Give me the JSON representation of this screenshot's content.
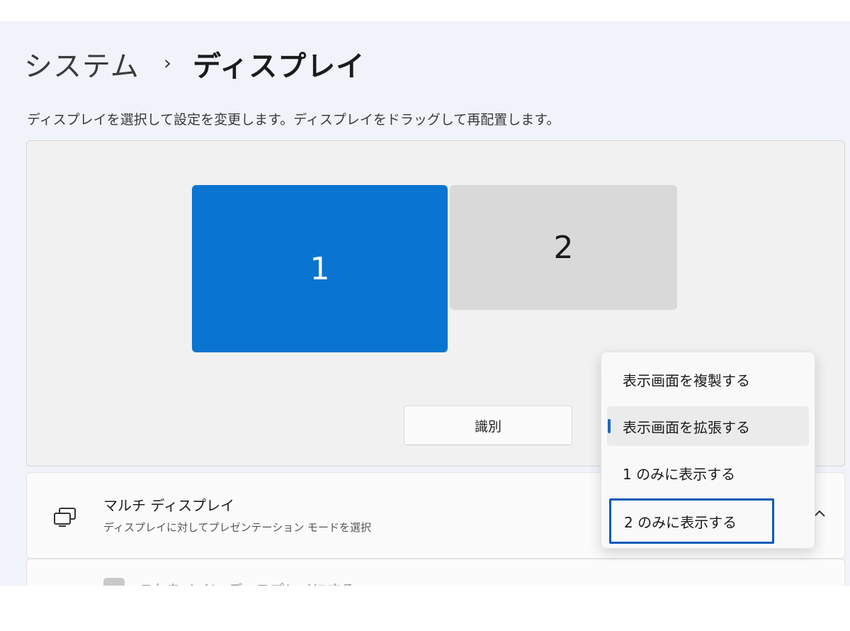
{
  "breadcrumb": {
    "parent": "システム",
    "separator": "›",
    "current": "ディスプレイ"
  },
  "description": "ディスプレイを選択して設定を変更します。ディスプレイをドラッグして再配置します。",
  "arrangement": {
    "monitors": [
      {
        "label": "1",
        "selected": true,
        "color": "#0a74d1"
      },
      {
        "label": "2",
        "selected": false,
        "color": "#d9d9d9"
      }
    ],
    "identify_label": "識別"
  },
  "multi_display": {
    "icon": "multi-display-icon",
    "title": "マルチ ディスプレイ",
    "subtitle": "ディスプレイに対してプレゼンテーション モードを選択"
  },
  "next_setting": {
    "label": "これをメイン ディスプレイにする"
  },
  "dropdown": {
    "options": [
      {
        "label": "表示画面を複製する",
        "selected": false
      },
      {
        "label": "表示画面を拡張する",
        "selected": true
      },
      {
        "label": "1 のみに表示する",
        "selected": false
      },
      {
        "label": "2 のみに表示する",
        "selected": false,
        "focused": true
      }
    ]
  },
  "colors": {
    "accent": "#0a74d1",
    "focus_outline": "#0b5bb5",
    "background": "#f0f3f9"
  }
}
